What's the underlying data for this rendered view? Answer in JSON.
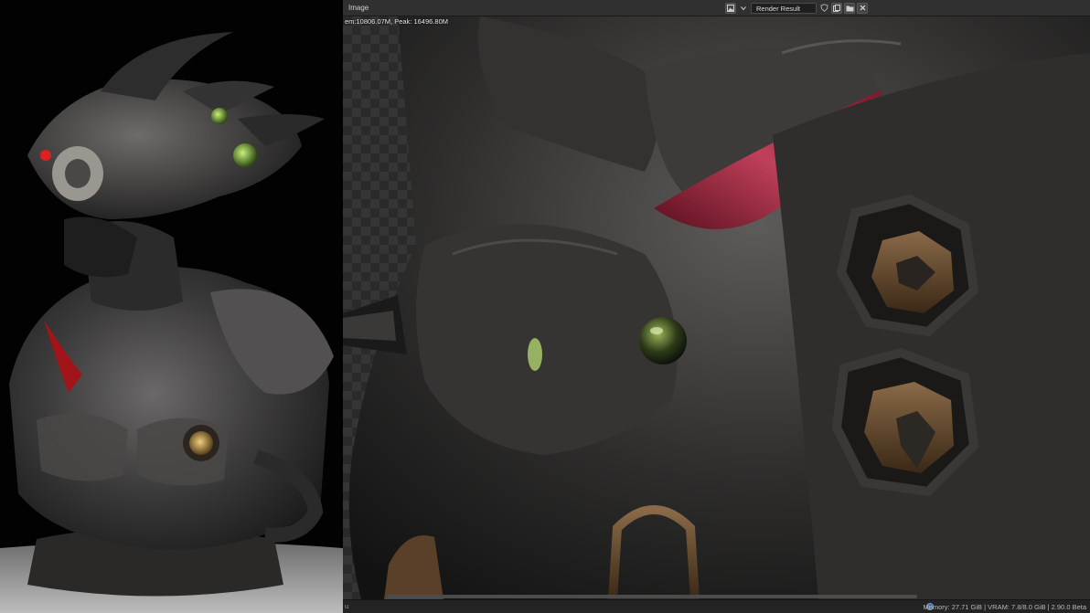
{
  "editor": {
    "name": "Image",
    "image_name": "Render Result",
    "memory_overlay": "em:10806.07M, Peak: 16496.80M"
  },
  "statusbar": {
    "left_text": "u",
    "right_text": "Memory: 27.71 GiB | VRAM: 7.8/8.0 GiB | 2.90.0 Beta"
  },
  "icons": {
    "image_type": "image-icon",
    "dropdown": "chevron-down-icon",
    "fake_user": "shield-icon",
    "new_image": "new-image-icon",
    "open_image": "folder-icon",
    "unlink": "close-icon",
    "status": "blender-status-icon"
  },
  "colors": {
    "header_bg": "#303030",
    "viewport_bg": "#2a2a2a",
    "statusbar_bg": "#232323",
    "text": "#d0d0d0"
  }
}
